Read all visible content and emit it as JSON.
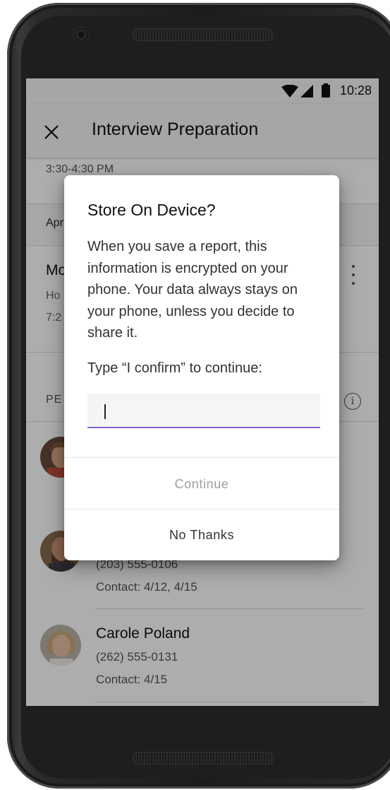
{
  "status_bar": {
    "time": "10:28"
  },
  "app_bar": {
    "title": "Interview Preparation",
    "close_icon": "close-icon"
  },
  "event": {
    "time_range": "3:30-4:30 PM",
    "date_label": "Apr",
    "title": "Mo",
    "sub1": "Ho",
    "sub2": "7:2",
    "more_icon": "more-vert-icon"
  },
  "people": {
    "section_label": "PE",
    "info_icon": "info-icon",
    "items": [
      {
        "name": "",
        "phone": "",
        "contact": ""
      },
      {
        "name": "",
        "phone": "(203) 555-0106",
        "contact": "Contact: 4/12, 4/15"
      },
      {
        "name": "Carole Poland",
        "phone": "(262) 555-0131",
        "contact": "Contact: 4/15"
      }
    ]
  },
  "dialog": {
    "title": "Store On Device?",
    "body": "When you save a report, this information is encrypted on your phone. Your data always stays on your phone, unless you decide to share it.",
    "prompt": "Type “I confirm” to continue:",
    "input_value": "",
    "continue_label": "Continue",
    "no_thanks_label": "No Thanks"
  },
  "colors": {
    "input_underline": "#8a63d2",
    "scrim": "rgba(0,0,0,0.32)",
    "disabled_text": "#9e9e9e"
  }
}
